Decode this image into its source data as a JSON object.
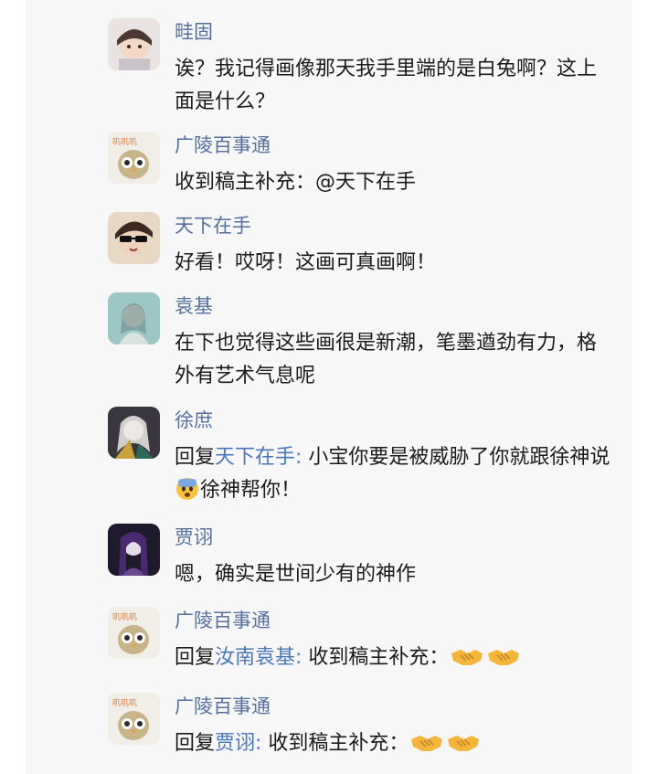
{
  "comments": [
    {
      "name": "畦固",
      "text": "诶？我记得画像那天我手里端的是白兔啊？这上面是什么？",
      "avatar": "avatar-young-man"
    },
    {
      "name": "广陵百事通",
      "text": "收到稿主补充：@天下在手",
      "avatar": "avatar-owl"
    },
    {
      "name": "天下在手",
      "text": "好看！哎呀！这画可真画啊！",
      "avatar": "avatar-sunglasses"
    },
    {
      "name": "袁基",
      "text": "在下也觉得这些画很是新潮，笔墨遒劲有力，格外有艺术气息呢",
      "avatar": "avatar-teal-figure"
    },
    {
      "name": "徐庶",
      "reply_label": "回复",
      "reply_to": "天下在手:",
      "text_before": " 小宝你要是被威胁了你就跟徐神说",
      "emoji": "fearful-face",
      "text_after": "徐神帮你！",
      "avatar": "avatar-white-hair"
    },
    {
      "name": "贾诩",
      "text": "嗯，确实是世间少有的神作",
      "avatar": "avatar-purple-hair"
    },
    {
      "name": "广陵百事通",
      "reply_label": "回复",
      "reply_to": "汝南袁基:",
      "text": " 收到稿主补充：",
      "emoji": "handshake x2",
      "avatar": "avatar-owl"
    },
    {
      "name": "广陵百事通",
      "reply_label": "回复",
      "reply_to": "贾诩:",
      "text": " 收到稿主补充：",
      "emoji": "handshake x2",
      "avatar": "avatar-owl"
    }
  ]
}
